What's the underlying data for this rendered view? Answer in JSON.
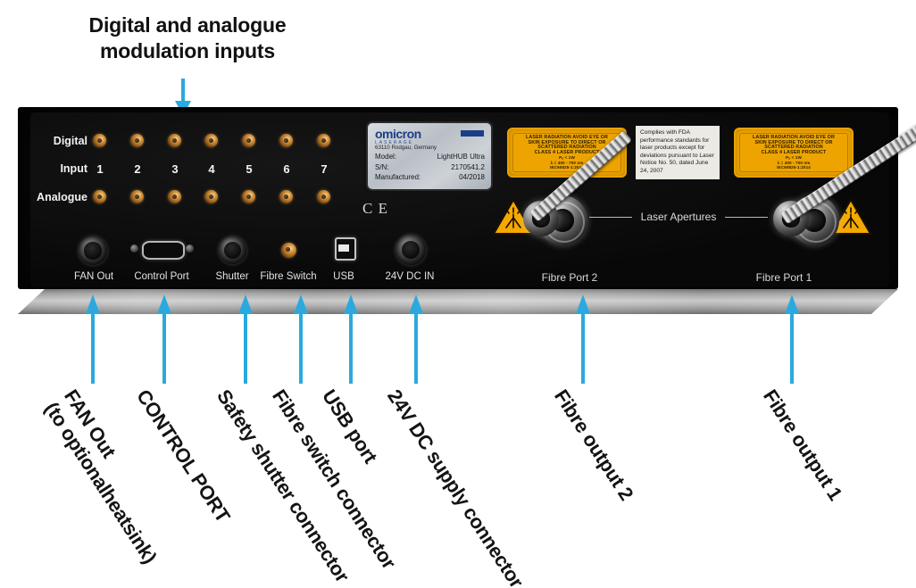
{
  "figure": {
    "top_caption_line1": "Digital and analogue",
    "top_caption_line2": "modulation inputs",
    "accent_color": "#2BA9DE",
    "panel_color": "#0a0a0a",
    "label_color": "#e9e9e9"
  },
  "panel": {
    "rows": {
      "digital_label": "Digital",
      "input_label": "Input",
      "analogue_label": "Analogue",
      "channel_numbers": [
        "1",
        "2",
        "3",
        "4",
        "5",
        "6",
        "7"
      ]
    },
    "connectors": [
      {
        "name": "fan-out",
        "label": "FAN Out"
      },
      {
        "name": "control-port",
        "label": "Control Port"
      },
      {
        "name": "shutter",
        "label": "Shutter"
      },
      {
        "name": "fibre-switch",
        "label": "Fibre Switch"
      },
      {
        "name": "usb",
        "label": "USB"
      },
      {
        "name": "dc-in",
        "label": "24V DC IN"
      }
    ],
    "ce_mark": "C E",
    "apertures": {
      "caption": "Laser Apertures",
      "port2_label": "Fibre Port 2",
      "port1_label": "Fibre Port 1"
    },
    "product_label": {
      "brand": "omicron",
      "brand_sub": "LASERAGE",
      "address": "63110 Rodgau, Germany",
      "rows": [
        {
          "key": "Model:",
          "value": "LightHUB Ultra"
        },
        {
          "key": "S/N:",
          "value": "2170541.2"
        },
        {
          "key": "Manufactured:",
          "value": "04/2018"
        }
      ]
    },
    "warning_label": {
      "lines": [
        "LASER RADIATION AVOID EYE OR",
        "SKIN EXPOSURE TO DIRECT OR",
        "SCATTERED RADIATION",
        "CLASS 4 LASER PRODUCT",
        "Pₒ < 1W",
        "λ = 400 - 700 nm",
        "IEC60825-1:2014"
      ]
    },
    "fda_label": {
      "text": "Complies with FDA performance standards for laser products except for deviations pursuant to Laser Notice No. 50, dated June 24, 2007"
    }
  },
  "annotations": [
    {
      "name": "fan-out",
      "line1": "FAN Out",
      "line2": "(to optionalheatsink)"
    },
    {
      "name": "control-port",
      "line1": "CONTROL PORT",
      "line2": ""
    },
    {
      "name": "safety-shutter",
      "line1": "Safety shutter connector",
      "line2": ""
    },
    {
      "name": "fibre-switch",
      "line1": "Fibre switch connector",
      "line2": ""
    },
    {
      "name": "usb-port",
      "line1": "USB port",
      "line2": ""
    },
    {
      "name": "dc-supply",
      "line1": "24V DC supply connector",
      "line2": ""
    },
    {
      "name": "fibre-output-2",
      "line1": "Fibre output 2",
      "line2": ""
    },
    {
      "name": "fibre-output-1",
      "line1": "Fibre output 1",
      "line2": ""
    }
  ]
}
